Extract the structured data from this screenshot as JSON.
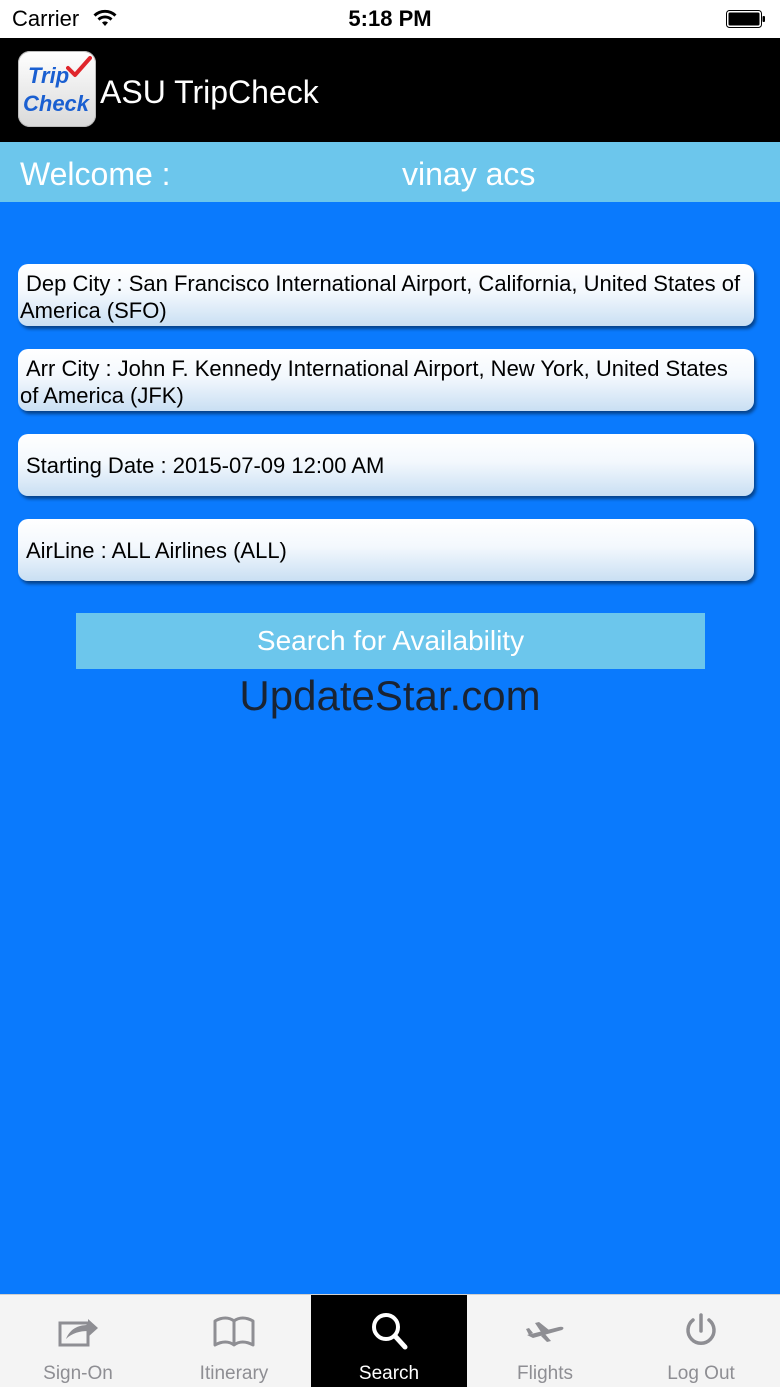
{
  "status_bar": {
    "carrier": "Carrier",
    "time": "5:18 PM",
    "icons": [
      "wifi-icon",
      "battery-icon"
    ]
  },
  "header": {
    "logo_text_top": "Trip",
    "logo_text_bottom": "Check",
    "title": "ASU TripCheck"
  },
  "welcome": {
    "label": "Welcome :",
    "user": "vinay acs"
  },
  "form": {
    "dep_city": "Dep City : San Francisco International Airport, California, United States of America (SFO)",
    "arr_city": "Arr City : John F. Kennedy International Airport, New York, United States of America (JFK)",
    "starting_date": "Starting Date : 2015-07-09 12:00 AM",
    "airline": "AirLine : ALL Airlines (ALL)",
    "search_button": "Search for Availability"
  },
  "watermark": "UpdateStar.com",
  "tabs": [
    {
      "label": "Sign-On",
      "icon": "share-icon",
      "active": false
    },
    {
      "label": "Itinerary",
      "icon": "book-icon",
      "active": false
    },
    {
      "label": "Search",
      "icon": "search-icon",
      "active": true
    },
    {
      "label": "Flights",
      "icon": "airplane-icon",
      "active": false
    },
    {
      "label": "Log Out",
      "icon": "power-icon",
      "active": false
    }
  ],
  "colors": {
    "background": "#0a7afd",
    "accent_bar": "#6cc6ec",
    "header": "#000000",
    "tab_active": "#000000"
  }
}
